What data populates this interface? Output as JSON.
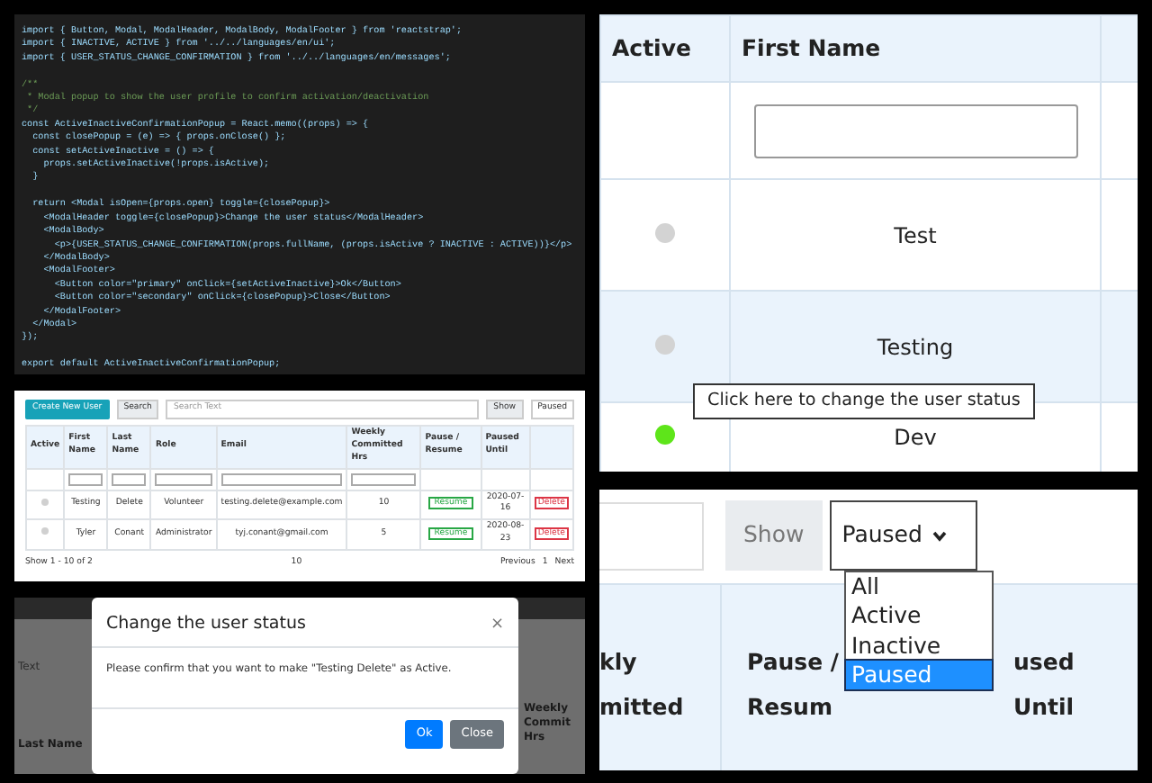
{
  "code_editor": {
    "lines": [
      {
        "kind": "code",
        "text": "import { Button, Modal, ModalHeader, ModalBody, ModalFooter } from 'reactstrap';"
      },
      {
        "kind": "code",
        "text": "import { INACTIVE, ACTIVE } from '../../languages/en/ui';"
      },
      {
        "kind": "code",
        "text": "import { USER_STATUS_CHANGE_CONFIRMATION } from '../../languages/en/messages';"
      },
      {
        "kind": "blank"
      },
      {
        "kind": "comment",
        "text": "/**"
      },
      {
        "kind": "comment",
        "text": " * Modal popup to show the user profile to confirm activation/deactivation"
      },
      {
        "kind": "comment",
        "text": " */"
      },
      {
        "kind": "code",
        "text": "const ActiveInactiveConfirmationPopup = React.memo((props) => {"
      },
      {
        "kind": "code",
        "text": "  const closePopup = (e) => { props.onClose() };"
      },
      {
        "kind": "code",
        "text": "  const setActiveInactive = () => {"
      },
      {
        "kind": "code",
        "text": "    props.setActiveInactive(!props.isActive);"
      },
      {
        "kind": "code",
        "text": "  }"
      },
      {
        "kind": "blank"
      },
      {
        "kind": "code",
        "text": "  return <Modal isOpen={props.open} toggle={closePopup}>"
      },
      {
        "kind": "code",
        "text": "    <ModalHeader toggle={closePopup}>Change the user status</ModalHeader>"
      },
      {
        "kind": "code",
        "text": "    <ModalBody>"
      },
      {
        "kind": "code",
        "text": "      <p>{USER_STATUS_CHANGE_CONFIRMATION(props.fullName, (props.isActive ? INACTIVE : ACTIVE))}</p>"
      },
      {
        "kind": "code",
        "text": "    </ModalBody>"
      },
      {
        "kind": "code",
        "text": "    <ModalFooter>"
      },
      {
        "kind": "code",
        "text": "      <Button color=\"primary\" onClick={setActiveInactive}>Ok</Button>"
      },
      {
        "kind": "code",
        "text": "      <Button color=\"secondary\" onClick={closePopup}>Close</Button>"
      },
      {
        "kind": "code",
        "text": "    </ModalFooter>"
      },
      {
        "kind": "code",
        "text": "  </Modal>"
      },
      {
        "kind": "code",
        "text": "});"
      },
      {
        "kind": "blank"
      },
      {
        "kind": "code",
        "text": "export default ActiveInactiveConfirmationPopup;"
      }
    ]
  },
  "users_overview": {
    "create_button": "Create New User",
    "search_label": "Search",
    "search_placeholder": "Search Text",
    "show_label": "Show",
    "show_value": "Paused",
    "columns": [
      "Active",
      "First Name",
      "Last Name",
      "Role",
      "Email",
      "Weekly Committed Hrs",
      "Pause / Resume",
      "Paused Until"
    ],
    "rows": [
      {
        "active": false,
        "first_name": "Testing",
        "last_name": "Delete",
        "role": "Volunteer",
        "email": "testing.delete@example.com",
        "hours": "10",
        "pause_button": "Resume",
        "paused_until": "2020-07-16",
        "delete_button": "Delete"
      },
      {
        "active": false,
        "first_name": "Tyler",
        "last_name": "Conant",
        "role": "Administrator",
        "email": "tyj.conant@gmail.com",
        "hours": "5",
        "pause_button": "Resume",
        "paused_until": "2020-08-23",
        "delete_button": "Delete"
      }
    ],
    "footer": {
      "summary": "Show 1 - 10 of 2",
      "page_size": "10",
      "previous": "Previous",
      "page": "1",
      "next": "Next"
    }
  },
  "status_table_zoom": {
    "columns": [
      "Active",
      "First Name"
    ],
    "rows": [
      {
        "first_name": "Test",
        "active": false
      },
      {
        "first_name": "Testing",
        "active": false
      },
      {
        "first_name": "Dev",
        "active": true
      }
    ],
    "tooltip": "Click here to change the user status"
  },
  "show_filter_zoom": {
    "show_label": "Show",
    "show_value": "Paused",
    "options": [
      {
        "label": "All",
        "selected": false
      },
      {
        "label": "Active",
        "selected": false
      },
      {
        "label": "Inactive",
        "selected": false
      },
      {
        "label": "Paused",
        "selected": true
      }
    ],
    "headers": [
      [
        "kly",
        "mitted"
      ],
      [
        "Pause /",
        "Resum"
      ],
      [
        "used Until"
      ]
    ]
  },
  "confirmation_modal": {
    "background": {
      "search_text": "Text",
      "column": "Last Name",
      "right_column": [
        "Weekly",
        "Commit",
        "Hrs"
      ]
    },
    "title": "Change the user status",
    "close": "×",
    "message": "Please confirm that you want to make \"Testing Delete\" as Active.",
    "buttons": [
      {
        "kind": "primary",
        "label": "Ok"
      },
      {
        "kind": "secondary",
        "label": "Close"
      }
    ]
  }
}
